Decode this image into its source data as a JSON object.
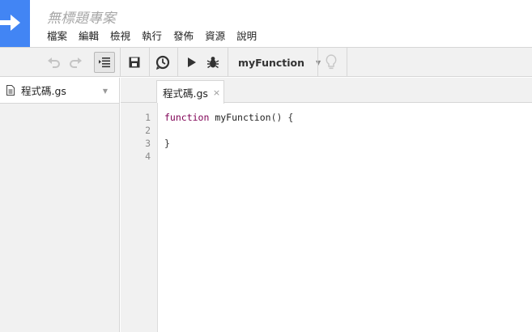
{
  "app": {
    "project_title": "無標題專案",
    "logo_icon": "arrow-right-icon",
    "accent_color": "#4285f4"
  },
  "menu": {
    "items": [
      {
        "label": "檔案"
      },
      {
        "label": "編輯"
      },
      {
        "label": "檢視"
      },
      {
        "label": "執行"
      },
      {
        "label": "發佈"
      },
      {
        "label": "資源"
      },
      {
        "label": "說明"
      }
    ]
  },
  "toolbar": {
    "undo_icon": "undo-icon",
    "redo_icon": "redo-icon",
    "indent_icon": "indent-icon",
    "save_icon": "save-icon",
    "triggers_icon": "clock-icon",
    "run_icon": "play-icon",
    "debug_icon": "bug-icon",
    "function_select": "myFunction",
    "hint_icon": "lightbulb-icon"
  },
  "sidebar": {
    "file_name": "程式碼.gs"
  },
  "editor": {
    "tab_label": "程式碼.gs",
    "tab_close": "×",
    "line_numbers": [
      "1",
      "2",
      "3",
      "4"
    ],
    "code": {
      "line1_keyword": "function",
      "line1_name": "myFunction",
      "line1_rest": "() {",
      "line3": "}"
    }
  }
}
